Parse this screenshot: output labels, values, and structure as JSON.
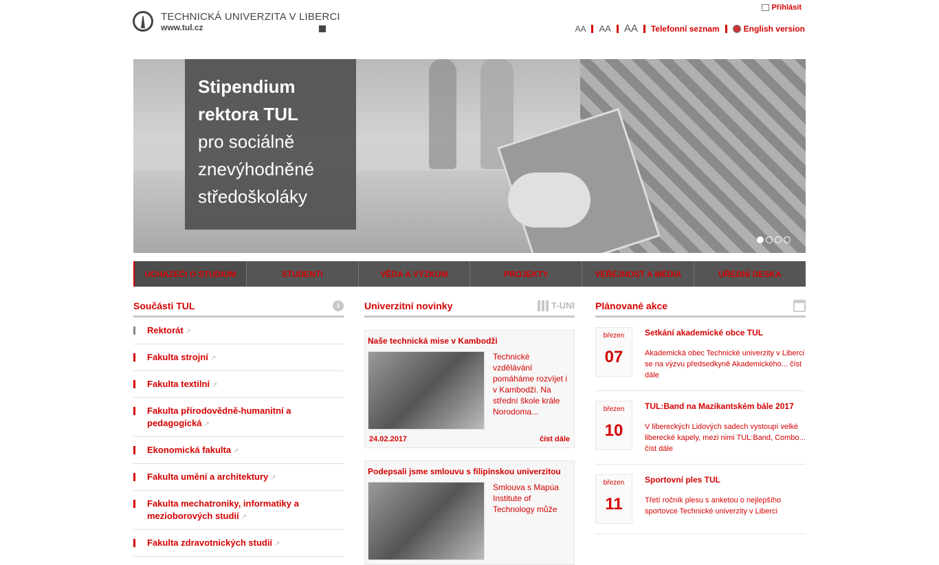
{
  "header": {
    "university": "TECHNICKÁ UNIVERZITA V LIBERCI",
    "url": "www.tul.cz",
    "login": "Přihlásit",
    "font_small": "AA",
    "font_medium": "AA",
    "font_large": "AA",
    "phone_book": "Telefonní seznam",
    "english": "English version"
  },
  "hero": {
    "title_bold_1": "Stipendium",
    "title_bold_2": "rektora TUL",
    "title_1": "pro sociálně",
    "title_2": "znevýhodněné",
    "title_3": "středoškoláky",
    "slides": 4,
    "active_slide": 1
  },
  "nav": [
    "UCHAZEČI O STUDIUM",
    "STUDENTI",
    "VĚDA A VÝZKUM",
    "PROJEKTY",
    "VEŘEJNOST A MÉDIA",
    "ÚŘEDNÍ DESKA"
  ],
  "components": {
    "title": "Součásti TUL",
    "info_icon": "i",
    "items": [
      "Rektorát",
      "Fakulta strojní",
      "Fakulta textilní",
      "Fakulta přírodovědně-humanitní a pedagogická",
      "Ekonomická fakulta",
      "Fakulta umění a architektury",
      "Fakulta mechatroniky, informatiky a mezioborových studií",
      "Fakulta zdravotnických studií"
    ]
  },
  "news": {
    "title": "Univerzitní novinky",
    "badge": "T-UNI",
    "items": [
      {
        "title": "Naše technická mise v Kambodži",
        "text": "Technické vzdělávání pomáháme rozvíjet i v Kambodži. Na střední škole krále Norodoma...",
        "date": "24.02.2017",
        "more": "číst dále"
      },
      {
        "title": "Podepsali jsme smlouvu s filipínskou univerzitou",
        "text": "Smlouva s Mapúa Institute of Technology může",
        "date": "",
        "more": ""
      }
    ]
  },
  "events": {
    "title": "Plánované akce",
    "items": [
      {
        "month": "březen",
        "day": "07",
        "title": "Setkání akademické obce TUL",
        "text": "Akademická obec Technické univerzity v Liberci se na výzvu předsedkyně Akademického... číst dále"
      },
      {
        "month": "březen",
        "day": "10",
        "title": "TUL:Band na Mazikantském bále 2017",
        "text": "V libereckých Lidových sadech vystoupí velké liberecké kapely, mezi nimi TUL:Band, Combo... číst dále"
      },
      {
        "month": "březen",
        "day": "11",
        "title": "Sportovní ples TUL",
        "text": "Třetí ročník plesu s anketou o nejlepšího sportovce Technické univerzity v Liberci"
      }
    ]
  }
}
